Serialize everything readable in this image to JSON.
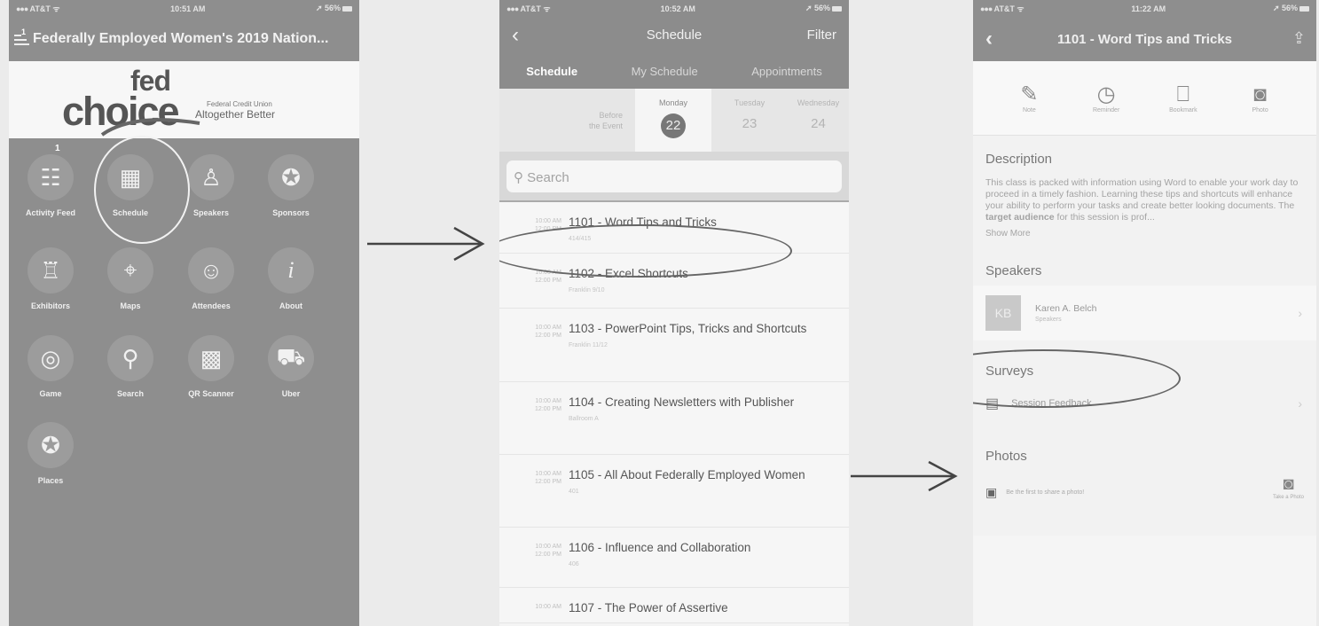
{
  "phone1": {
    "status": {
      "carrier": "AT&T",
      "time": "10:51 AM",
      "battery": "56%"
    },
    "title": "Federally Employed Women's 2019 Nation...",
    "menu_badge": "1",
    "banner": {
      "fed": "fed",
      "choice": "choice",
      "fcu": "Federal Credit Union",
      "tagline": "Altogether Better"
    },
    "feed_badge": "1",
    "tiles": [
      {
        "label": "Activity Feed",
        "icon": "activity-feed-icon",
        "glyph": "☷"
      },
      {
        "label": "Schedule",
        "icon": "calendar-icon",
        "glyph": "▦"
      },
      {
        "label": "Speakers",
        "icon": "speaker-icon",
        "glyph": "♙"
      },
      {
        "label": "Sponsors",
        "icon": "ribbon-icon",
        "glyph": "✪"
      },
      {
        "label": "Exhibitors",
        "icon": "booth-icon",
        "glyph": "♖"
      },
      {
        "label": "Maps",
        "icon": "map-icon",
        "glyph": "⌖"
      },
      {
        "label": "Attendees",
        "icon": "attendees-icon",
        "glyph": "☺"
      },
      {
        "label": "About",
        "icon": "info-icon",
        "glyph": "i"
      },
      {
        "label": "Game",
        "icon": "gamepad-icon",
        "glyph": "◎"
      },
      {
        "label": "Search",
        "icon": "search-icon",
        "glyph": "⚲"
      },
      {
        "label": "QR Scanner",
        "icon": "qr-icon",
        "glyph": "▩"
      },
      {
        "label": "Uber",
        "icon": "car-icon",
        "glyph": "⛟"
      },
      {
        "label": "Places",
        "icon": "place-pin-icon",
        "glyph": "✪"
      }
    ]
  },
  "phone2": {
    "status": {
      "carrier": "AT&T",
      "time": "10:52 AM",
      "battery": "56%"
    },
    "title": "Schedule",
    "filter": "Filter",
    "tabs": [
      "Schedule",
      "My Schedule",
      "Appointments"
    ],
    "days": [
      {
        "name": "Before",
        "sub": "the Event"
      },
      {
        "name": "Monday",
        "num": "22"
      },
      {
        "name": "Tuesday",
        "num": "23"
      },
      {
        "name": "Wednesday",
        "num": "24"
      }
    ],
    "search_placeholder": "Search",
    "sessions": [
      {
        "start": "10:00 AM",
        "end": "12:00 PM",
        "title": "1101 - Word Tips and Tricks",
        "room": "414/415"
      },
      {
        "start": "10:00 AM",
        "end": "12:00 PM",
        "title": "1102 - Excel Shortcuts",
        "room": "Franklin 9/10"
      },
      {
        "start": "10:00 AM",
        "end": "12:00 PM",
        "title": "1103 - PowerPoint Tips, Tricks and Shortcuts",
        "room": "Franklin 11/12"
      },
      {
        "start": "10:00 AM",
        "end": "12:00 PM",
        "title": "1104 - Creating Newsletters with Publisher",
        "room": "Ballroom A"
      },
      {
        "start": "10:00 AM",
        "end": "12:00 PM",
        "title": "1105 - All About Federally Employed Women",
        "room": "401"
      },
      {
        "start": "10:00 AM",
        "end": "12:00 PM",
        "title": "1106 - Influence and Collaboration",
        "room": "406"
      },
      {
        "start": "10:00 AM",
        "end": "",
        "title": "1107 - The Power of Assertive",
        "room": ""
      }
    ]
  },
  "phone3": {
    "status": {
      "carrier": "AT&T",
      "time": "11:22 AM",
      "battery": "56%"
    },
    "title": "1101 - Word Tips and Tricks",
    "actions": [
      {
        "label": "Note",
        "icon": "note-icon",
        "glyph": "✎"
      },
      {
        "label": "Reminder",
        "icon": "clock-icon",
        "glyph": "◷"
      },
      {
        "label": "Bookmark",
        "icon": "bookmark-icon",
        "glyph": "⎕"
      },
      {
        "label": "Photo",
        "icon": "camera-icon",
        "glyph": "◙"
      }
    ],
    "description": {
      "heading": "Description",
      "text_plain": "This class is packed with information using Word to enable your work day to proceed in a timely fashion. Learning these tips and shortcuts will enhance your ability to perform your tasks and create better looking documents. The ",
      "text_bold": "target audience",
      "text_end": " for this session is prof...",
      "show_more": "Show More"
    },
    "speakers": {
      "heading": "Speakers",
      "initials": "KB",
      "name": "Karen A. Belch",
      "role": "Speakers"
    },
    "surveys": {
      "heading": "Surveys",
      "item": "Session Feedback"
    },
    "photos": {
      "heading": "Photos",
      "prompt": "Be the first to share a photo!",
      "take": "Take a Photo"
    }
  }
}
